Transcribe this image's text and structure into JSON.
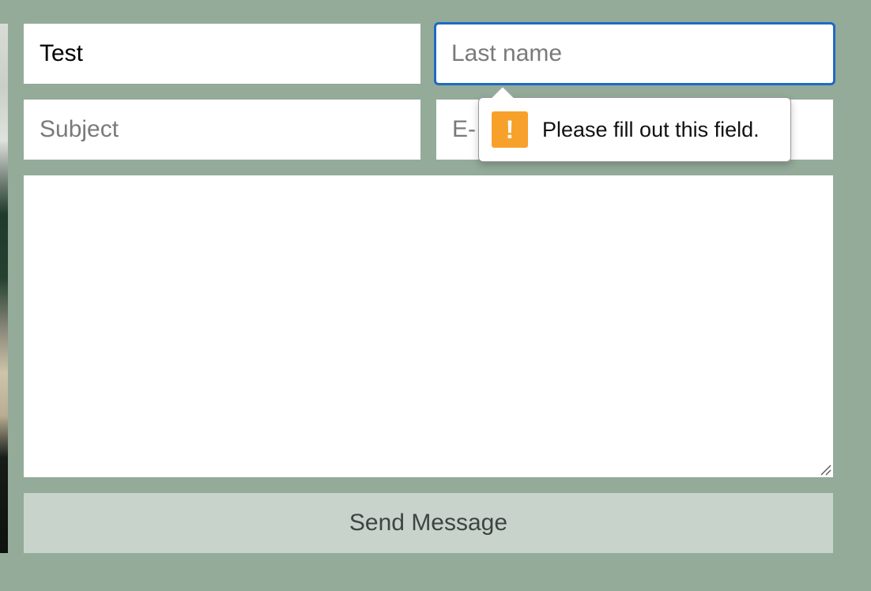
{
  "form": {
    "first_name": {
      "value": "Test"
    },
    "last_name": {
      "value": "",
      "placeholder": "Last name"
    },
    "subject": {
      "value": "",
      "placeholder": "Subject"
    },
    "email": {
      "value": "",
      "placeholder": "E-"
    },
    "message": {
      "value": ""
    },
    "send_label": "Send Message"
  },
  "validation": {
    "message": "Please fill out this field.",
    "icon": "warning-icon",
    "icon_glyph": "!",
    "icon_color": "#f7a12b"
  },
  "colors": {
    "background": "#94ab9a",
    "focus_ring": "#1f6ac4",
    "button_bg": "#c8d4cb"
  }
}
